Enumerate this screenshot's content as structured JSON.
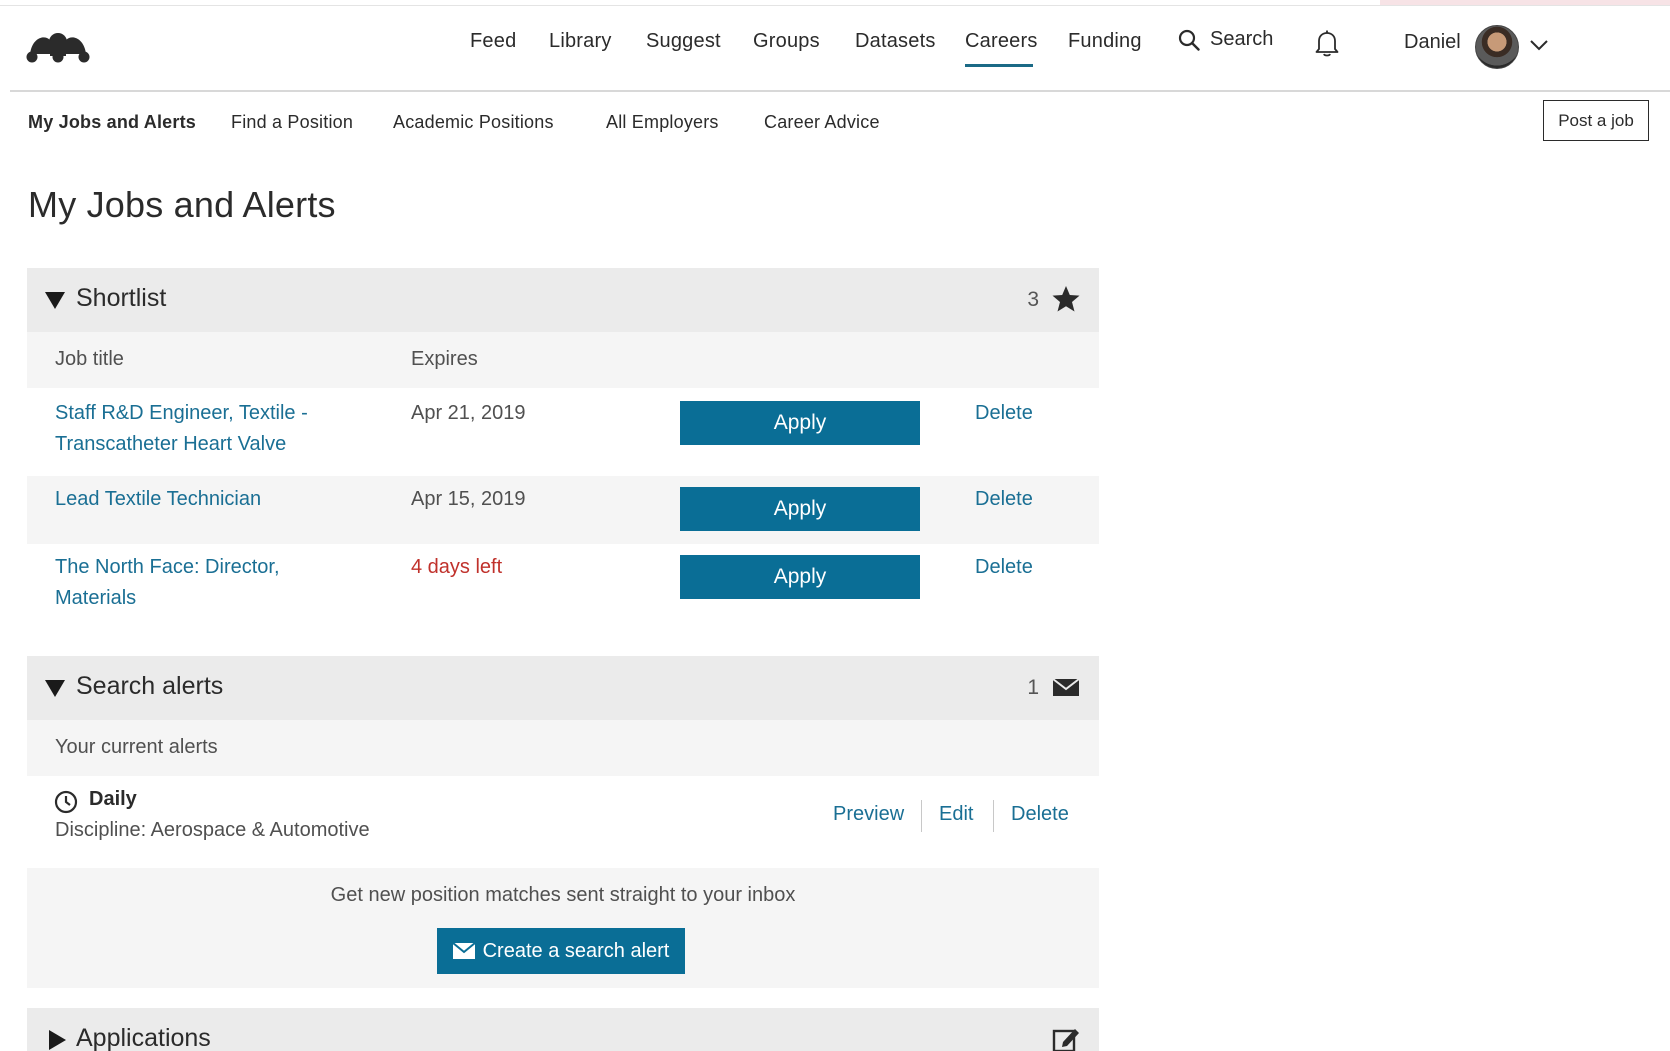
{
  "nav": {
    "items": [
      "Feed",
      "Library",
      "Suggest",
      "Groups",
      "Datasets",
      "Careers",
      "Funding"
    ],
    "search_label": "Search",
    "user_name": "Daniel",
    "active": "Careers"
  },
  "subnav": {
    "items": [
      "My Jobs and Alerts",
      "Find a Position",
      "Academic Positions",
      "All Employers",
      "Career Advice"
    ],
    "active": "My Jobs and Alerts",
    "post_job_label": "Post a job"
  },
  "page": {
    "title": "My Jobs and Alerts"
  },
  "shortlist": {
    "title": "Shortlist",
    "count": "3",
    "icon": "star-icon",
    "col_job_title": "Job title",
    "col_expires": "Expires",
    "rows": [
      {
        "title_line1": "Staff R&D Engineer, Textile -",
        "title_line2": "Transcatheter Heart Valve",
        "expires": "Apr 21, 2019",
        "apply": "Apply",
        "delete": "Delete"
      },
      {
        "title_line1": "Lead Textile Technician",
        "title_line2": "",
        "expires": "Apr 15, 2019",
        "apply": "Apply",
        "delete": "Delete"
      },
      {
        "title_line1": "The North Face: Director,",
        "title_line2": "Materials",
        "expires": "4 days left",
        "apply": "Apply",
        "delete": "Delete"
      }
    ]
  },
  "search_alerts": {
    "title": "Search alerts",
    "count": "1",
    "icon": "envelope-icon",
    "subheading": "Your current alerts",
    "alert": {
      "frequency": "Daily",
      "discipline": "Discipline: Aerospace & Automotive",
      "preview": "Preview",
      "edit": "Edit",
      "delete": "Delete"
    },
    "cta_message": "Get new position matches sent straight to your inbox",
    "cta_button": "Create a search alert"
  },
  "applications": {
    "title": "Applications",
    "icon": "edit-icon"
  },
  "colors": {
    "link": "#1a6f94",
    "button": "#0a6e96",
    "urgent": "#c0312b",
    "header_bg": "#ebebeb",
    "subheader_bg": "#f5f5f5"
  }
}
